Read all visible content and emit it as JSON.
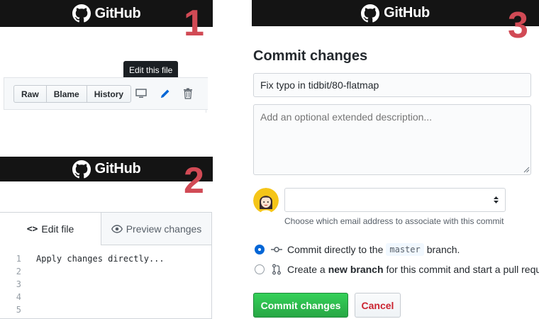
{
  "brand": {
    "name": "GitHub"
  },
  "steps": [
    "1",
    "2",
    "3"
  ],
  "panel1": {
    "tooltip": "Edit this file",
    "buttons": [
      "Raw",
      "Blame",
      "History"
    ],
    "icons": [
      "desktop-icon",
      "pencil-icon",
      "trash-icon"
    ]
  },
  "panel2": {
    "tabs": {
      "edit": "Edit file",
      "preview": "Preview changes"
    },
    "lines": [
      {
        "n": "1",
        "text": "Apply changes directly..."
      },
      {
        "n": "2",
        "text": ""
      },
      {
        "n": "3",
        "text": ""
      },
      {
        "n": "4",
        "text": ""
      },
      {
        "n": "5",
        "text": ""
      }
    ]
  },
  "panel3": {
    "title": "Commit changes",
    "summary_value": "Fix typo in tidbit/80-flatmap",
    "description_placeholder": "Add an optional extended description...",
    "email_help": "Choose which email address to associate with this commit",
    "option_direct": {
      "prefix": "Commit directly to the",
      "branch": "master",
      "suffix": "branch."
    },
    "option_new": {
      "prefix": "Create a",
      "bold": "new branch",
      "suffix": "for this commit and start a pull request."
    },
    "commit_button": "Commit changes",
    "cancel_button": "Cancel"
  },
  "colors": {
    "bar": "#141414",
    "step": "#d14a55",
    "primary": "#28a745",
    "link": "#0366d6",
    "danger": "#cb2431"
  }
}
